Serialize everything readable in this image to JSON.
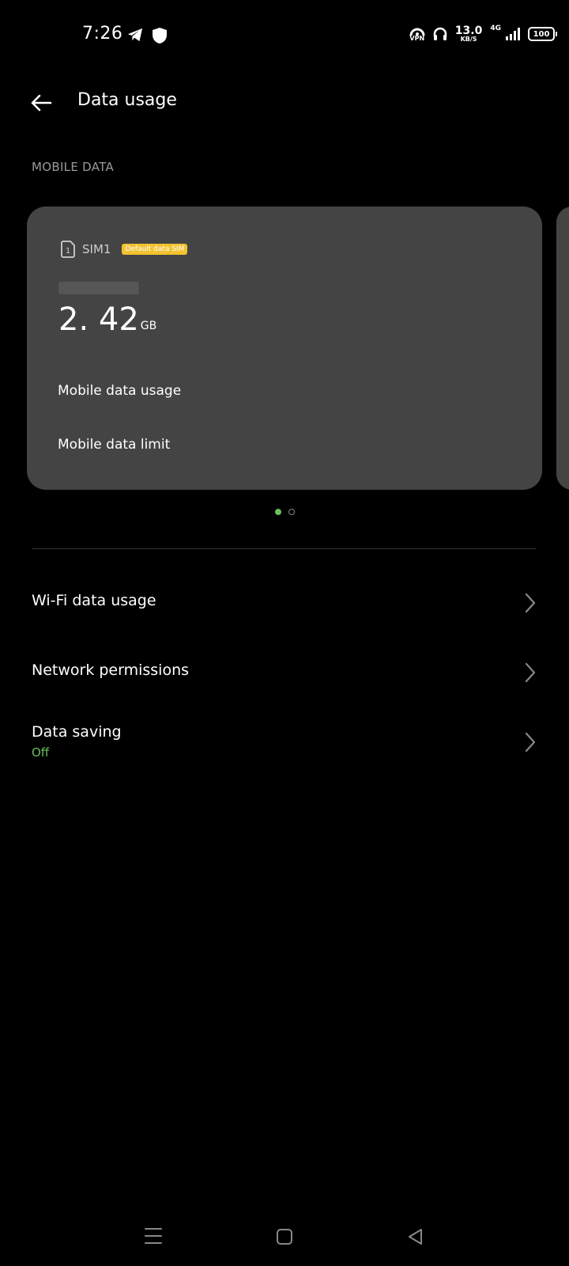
{
  "status_bar": {
    "time": "7:26",
    "vpn_label": "VPN",
    "net_speed_value": "13.0",
    "net_speed_unit": "KB/S",
    "network_type": "4G",
    "battery": "100"
  },
  "header": {
    "title": "Data usage"
  },
  "mobile_data": {
    "section_label": "MOBILE DATA",
    "sim_name": "SIM1",
    "sim_badge": "Default data SIM",
    "usage_value": "2. 42",
    "usage_unit": "GB",
    "link_usage": "Mobile data usage",
    "link_limit": "Mobile data limit",
    "pager": {
      "count": 2,
      "active_index": 0
    }
  },
  "settings": [
    {
      "label": "Wi-Fi data usage"
    },
    {
      "label": "Network permissions"
    },
    {
      "label": "Data saving",
      "sublabel": "Off"
    }
  ],
  "colors": {
    "accent_green": "#6bbf59",
    "badge_yellow": "#f2c230",
    "card_bg": "#444444"
  }
}
